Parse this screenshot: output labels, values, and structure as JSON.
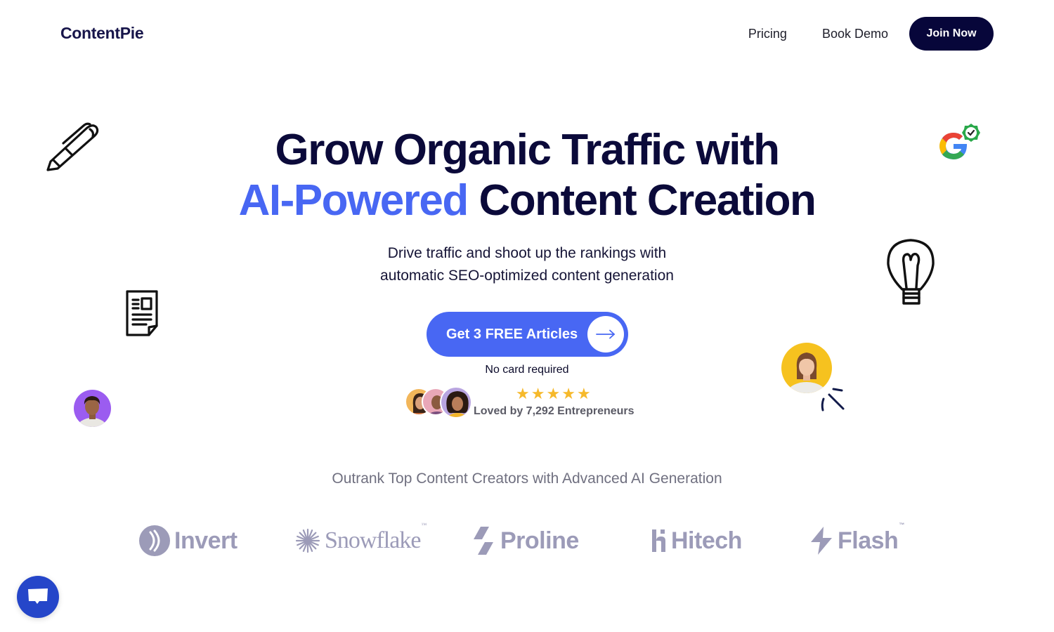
{
  "header": {
    "logo": "ContentPie",
    "nav": [
      {
        "label": "Pricing"
      },
      {
        "label": "Book Demo"
      }
    ],
    "join_label": "Join Now"
  },
  "hero": {
    "title_line1": "Grow Organic Traffic with",
    "title_accent": "AI-Powered",
    "title_line2_rest": " Content Creation",
    "subtitle_line1": "Drive traffic and shoot up the rankings with",
    "subtitle_line2": "automatic SEO-optimized content generation",
    "cta_label": "Get 3 FREE Articles",
    "cta_icon": "arrow-right-icon",
    "no_card": "No card required",
    "rating_stars": 5,
    "loved_text": "Loved by 7,292 Entrepreneurs"
  },
  "decorations": {
    "icons": [
      "pen-icon",
      "document-icon",
      "lightbulb-icon",
      "google-verified-icon",
      "sparkle-lines-icon"
    ]
  },
  "logos_section": {
    "title": "Outrank Top Content Creators with Advanced AI Generation",
    "logos": [
      {
        "name": "Invert"
      },
      {
        "name": "Snowflake",
        "tm": "™"
      },
      {
        "name": "Proline"
      },
      {
        "name": "Hitech"
      },
      {
        "name": "Flash",
        "tm": "™"
      }
    ]
  },
  "colors": {
    "navy": "#0b0a3a",
    "accent_blue": "#4867f3",
    "star_yellow": "#f6b92b",
    "logo_gray": "#9c9bb8",
    "chat_blue": "#2546c9"
  },
  "chat": {
    "icon": "chat-bubble-icon"
  }
}
